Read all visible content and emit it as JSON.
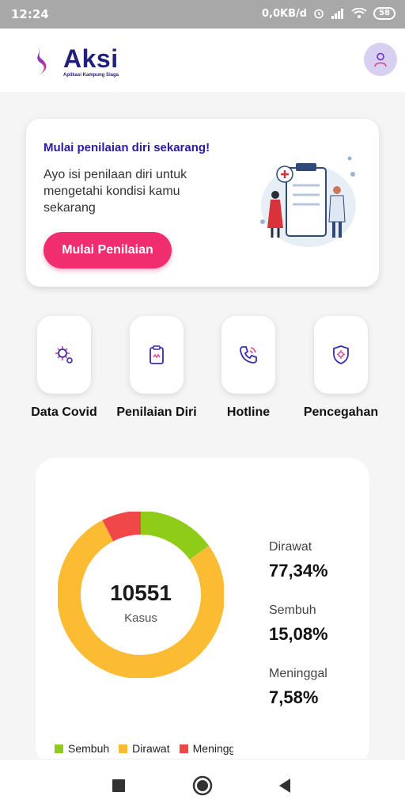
{
  "status_bar": {
    "time": "12:24",
    "network_speed": "0,0KB/d",
    "battery": "58"
  },
  "header": {
    "app_name": "Aksi",
    "app_tagline": "Aplikasi Kampung Siaga",
    "brand_color": "#21207a"
  },
  "assessment_card": {
    "title": "Mulai penilaian diri sekarang!",
    "description": "Ayo isi penilaan diri untuk mengetahi kondisi kamu sekarang",
    "button_label": "Mulai Penilaian",
    "accent_color": "#ef2d6f"
  },
  "menu": [
    {
      "label": "Data Covid",
      "icon": "virus-icon"
    },
    {
      "label": "Penilaian Diri",
      "icon": "clipboard-icon"
    },
    {
      "label": "Hotline",
      "icon": "phone-icon"
    },
    {
      "label": "Pencegahan",
      "icon": "shield-icon"
    }
  ],
  "chart_data": {
    "type": "pie",
    "center_value": "10551",
    "center_label": "Kasus",
    "categories": [
      "Dirawat",
      "Sembuh",
      "Meninggal"
    ],
    "values": [
      77.34,
      15.08,
      7.58
    ],
    "value_labels": [
      "77,34%",
      "15,08%",
      "7,58%"
    ],
    "colors": [
      "#fbbb33",
      "#8fcc1a",
      "#f04848"
    ],
    "legend": [
      "Sembuh",
      "Dirawat",
      "Meningg"
    ],
    "legend_colors": [
      "#8fcc1a",
      "#fbbb33",
      "#f04848"
    ]
  },
  "navigation": {
    "buttons": [
      "recent-apps",
      "home",
      "back"
    ]
  }
}
